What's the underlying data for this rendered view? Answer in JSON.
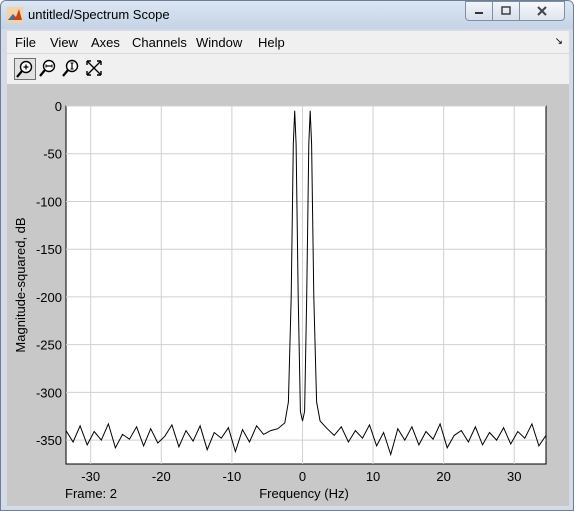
{
  "window": {
    "title": "untitled/Spectrum Scope"
  },
  "menu": [
    {
      "label": "File"
    },
    {
      "label": "View"
    },
    {
      "label": "Axes"
    },
    {
      "label": "Channels"
    },
    {
      "label": "Window"
    },
    {
      "label": "Help"
    }
  ],
  "toolbar": {
    "tools": [
      "zoom-in-icon",
      "zoom-x-icon",
      "zoom-y-icon",
      "autoscale-icon"
    ]
  },
  "status": {
    "frame_label": "Frame: 2"
  },
  "chart_data": {
    "type": "line",
    "xlabel": "Frequency (Hz)",
    "ylabel": "Magnitude-squared, dB",
    "xlim": [
      -33.5,
      34.5
    ],
    "ylim": [
      -375,
      0
    ],
    "xticks": [
      -30,
      -20,
      -10,
      0,
      10,
      20,
      30
    ],
    "yticks": [
      0,
      -50,
      -100,
      -150,
      -200,
      -250,
      -300,
      -350
    ],
    "grid": true,
    "series": [
      {
        "color": "#000000",
        "x": [
          -33.5,
          -32.5,
          -31.5,
          -30.5,
          -29.5,
          -28.5,
          -27.5,
          -26.5,
          -25.5,
          -24.5,
          -23.5,
          -22.5,
          -21.5,
          -20.5,
          -19.5,
          -18.5,
          -17.5,
          -16.5,
          -15.5,
          -14.5,
          -13.5,
          -12.5,
          -11.5,
          -10.5,
          -9.5,
          -8.5,
          -7.5,
          -6.5,
          -5.5,
          -4.5,
          -3.5,
          -2.5,
          -2,
          -1.6,
          -1.3,
          -1.1,
          -0.9,
          -0.6,
          -0.3,
          0,
          0.3,
          0.6,
          0.9,
          1.1,
          1.3,
          1.6,
          2,
          2.5,
          3.5,
          4.5,
          5.5,
          6.5,
          7.5,
          8.5,
          9.5,
          10.5,
          11.5,
          12.5,
          13.5,
          14.5,
          15.5,
          16.5,
          17.5,
          18.5,
          19.5,
          20.5,
          21.5,
          22.5,
          23.5,
          24.5,
          25.5,
          26.5,
          27.5,
          28.5,
          29.5,
          30.5,
          31.5,
          32.5,
          33.5,
          34.5
        ],
        "y": [
          -340,
          -352,
          -335,
          -355,
          -341,
          -350,
          -333,
          -358,
          -344,
          -349,
          -336,
          -356,
          -338,
          -353,
          -346,
          -334,
          -357,
          -340,
          -351,
          -335,
          -360,
          -342,
          -348,
          -337,
          -362,
          -339,
          -352,
          -335,
          -344,
          -340,
          -338,
          -332,
          -310,
          -200,
          -40,
          -5,
          -40,
          -200,
          -320,
          -330,
          -320,
          -200,
          -40,
          -5,
          -40,
          -200,
          -310,
          -330,
          -338,
          -345,
          -336,
          -352,
          -340,
          -348,
          -334,
          -356,
          -342,
          -365,
          -338,
          -350,
          -336,
          -355,
          -341,
          -349,
          -333,
          -358,
          -345,
          -340,
          -352,
          -336,
          -355,
          -342,
          -350,
          -337,
          -354,
          -341,
          -348,
          -333,
          -356,
          -345
        ]
      }
    ]
  }
}
